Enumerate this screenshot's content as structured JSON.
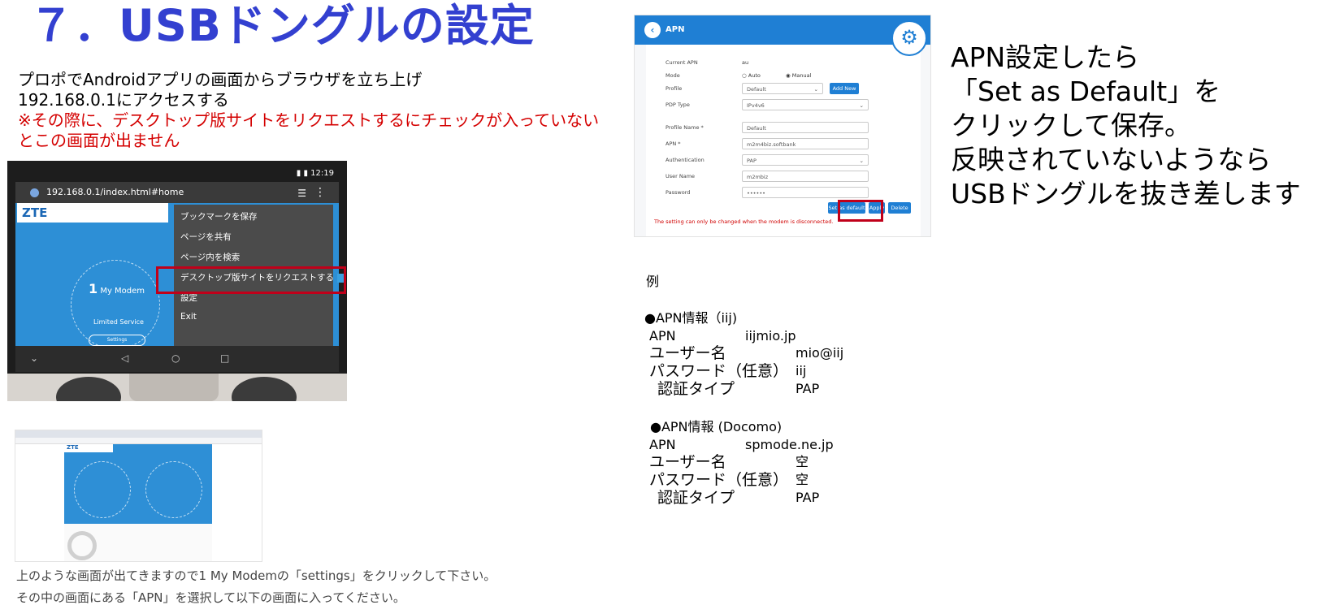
{
  "title": "７．USBドングルの設定",
  "intro": {
    "line1": "プロポでAndroidアプリの画面からブラウザを立ち上げ",
    "line2": "192.168.0.1にアクセスする",
    "warn1": "※その際に、デスクトップ版サイトをリクエストするにチェックが入っていない",
    "warn2": "とこの画面が出ません"
  },
  "phone": {
    "time": "12:19",
    "url": "192.168.0.1/index.html#home",
    "logo": "ZTE",
    "modem_label": "My Modem",
    "modem_number": "1",
    "status": "Limited Service",
    "settings_btn": "Settings",
    "menu": [
      "ブックマークを保存",
      "ページを共有",
      "ページ内を検索",
      "デスクトップ版サイトをリクエストする",
      "設定",
      "Exit"
    ],
    "desktop_checked": true
  },
  "thumb": {
    "logo": "ZTE"
  },
  "caption": {
    "line1": "上のような画面が出てきますので1 My Modemの「settings」をクリックして下さい。",
    "line2": "その中の画面にある「APN」を選択して以下の画面に入ってください。"
  },
  "apn": {
    "header": "APN",
    "labels": {
      "current_apn": "Current APN",
      "mode": "Mode",
      "profile": "Profile",
      "pdp_type": "PDP Type",
      "profile_name": "Profile Name *",
      "apn": "APN *",
      "authentication": "Authentication",
      "user_name": "User Name",
      "password": "Password"
    },
    "values": {
      "current_apn": "au",
      "mode_auto": "Auto",
      "mode_manual": "Manual",
      "mode_selected": "Manual",
      "profile": "Default",
      "pdp_type": "IPv4v6",
      "profile_name": "Default",
      "apn": "m2m4biz.softbank",
      "authentication": "PAP",
      "user_name": "m2mbiz",
      "password": "••••••"
    },
    "buttons": {
      "add_new": "Add New",
      "set_default": "Set as default",
      "apply": "Apply",
      "delete": "Delete"
    },
    "note": "The setting can only be changed when the modem is disconnected."
  },
  "instructions": [
    "APN設定したら",
    "「Set as Default」を",
    "クリックして保存。",
    "反映されていないようなら",
    "USBドングルを抜き差します"
  ],
  "example": {
    "heading": "例",
    "blocks": [
      {
        "title": "●APN情報（iij)",
        "rows": [
          {
            "label": "APN",
            "value": "iijmio.jp"
          },
          {
            "label": "ユーザー名",
            "value": "mio@iij"
          },
          {
            "label": "パスワード（任意）",
            "value": "iij"
          },
          {
            "label": "認証タイプ",
            "value": "PAP"
          }
        ]
      },
      {
        "title": "●APN情報 (Docomo)",
        "rows": [
          {
            "label": "APN",
            "value": "spmode.ne.jp"
          },
          {
            "label": "ユーザー名",
            "value": "空"
          },
          {
            "label": "パスワード（任意）",
            "value": "空"
          },
          {
            "label": "認証タイプ",
            "value": "PAP"
          }
        ]
      }
    ]
  },
  "colors": {
    "title": "#3340d0",
    "warning": "#d40000",
    "highlight_box": "#c0001a",
    "apn_blue": "#1f7fd4"
  }
}
